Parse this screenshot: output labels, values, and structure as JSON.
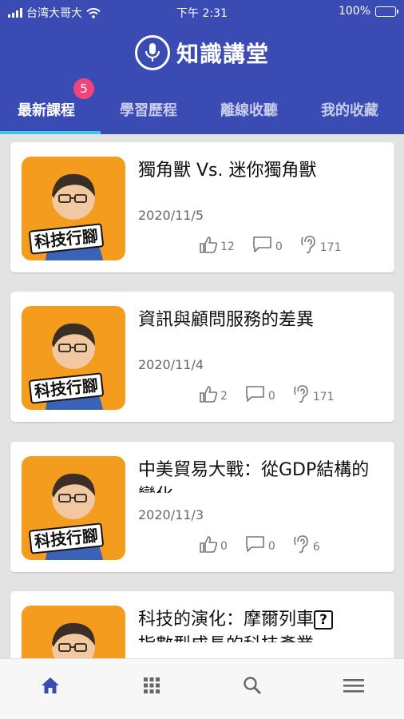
{
  "status_bar": {
    "carrier": "台湾大哥大",
    "time": "下午 2:31",
    "battery": "100%"
  },
  "app": {
    "title": "知識講堂",
    "icon": "microphone-icon"
  },
  "tabs": [
    {
      "label": "最新課程",
      "active": true,
      "badge": "5"
    },
    {
      "label": "學習歷程",
      "active": false
    },
    {
      "label": "離線收聽",
      "active": false
    },
    {
      "label": "我的收藏",
      "active": false
    }
  ],
  "thumb_label": "科技行腳",
  "cards": [
    {
      "title": "獨角獸 Vs. 迷你獨角獸",
      "date": "2020/11/5",
      "likes": "12",
      "comments": "0",
      "listens": "171"
    },
    {
      "title": "資訊與顧問服務的差異",
      "date": "2020/11/4",
      "likes": "2",
      "comments": "0",
      "listens": "171"
    },
    {
      "title": "中美貿易大戰：從GDP結構的變化",
      "date": "2020/11/3",
      "likes": "0",
      "comments": "0",
      "listens": "6"
    },
    {
      "title_before": "科技的演化：摩爾列車",
      "title_mark": "?",
      "title_after": "指數型成長的科技產業"
    }
  ],
  "bottom_nav": [
    {
      "name": "home-icon",
      "active": true
    },
    {
      "name": "grid-icon",
      "active": false
    },
    {
      "name": "search-icon",
      "active": false
    },
    {
      "name": "menu-icon",
      "active": false
    }
  ],
  "colors": {
    "primary": "#3a4bb3",
    "indicator": "#3ec7f0",
    "badge": "#f0457a",
    "thumb": "#f39c1d",
    "nav_active": "#3a4bb3",
    "nav_inactive": "#666666"
  }
}
